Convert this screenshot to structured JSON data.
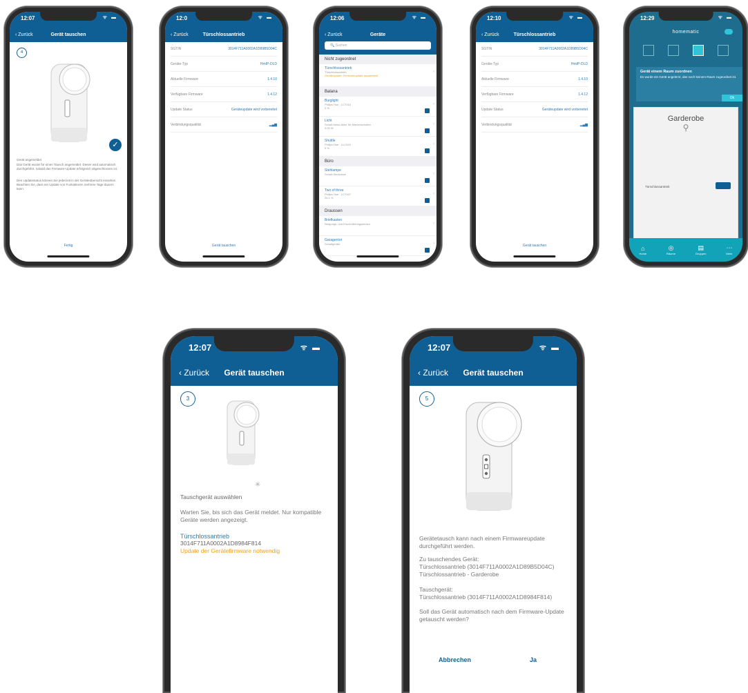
{
  "phones": [
    {
      "time": "12:07",
      "back_label": "Zurück",
      "title": "Gerät tauschen",
      "step": "4",
      "check_icon": "check-circle-icon",
      "text1_title": "Gerät angemeldet",
      "text1_body": "Das Gerät wurde für einen Tausch angemeldet. Dieser wird automatisch durchgeführt, sobald das Firmware-Update erfolgreich abgeschlossen ist.",
      "text2_body": "Den Updatestatus können Sie jederzeit in der Geräteübersicht einsehen. Beachten Sie, dass ein Update von Funkaktoren mehrere Tage dauern kann.",
      "footer": "Fertig"
    },
    {
      "time": "12:0",
      "back_label": "Zurück",
      "title": "Türschlossantrieb",
      "rows": [
        {
          "k": "SGTIN",
          "v": "3014F711A0002A1D89B5D04C"
        },
        {
          "k": "Geräte-Typ",
          "v": "HmIP-DLD"
        },
        {
          "k": "Aktuelle Firmware",
          "v": "1.4.10"
        },
        {
          "k": "Verfügbare Firmware",
          "v": "1.4.12"
        },
        {
          "k": "Update Status",
          "v": "Geräteupdate wird vorbereitet"
        },
        {
          "k": "Verbindungsqualität",
          "v": ""
        }
      ],
      "footer": "Gerät tauschen"
    },
    {
      "time": "12:06",
      "back_label": "Zurück",
      "title": "Geräte",
      "search_placeholder": "Suchen",
      "sections": [
        {
          "header": "Nicht zugeordnet",
          "items": [
            {
              "name": "Türschlossantrieb",
              "sub": "Türschlossantrieb",
              "warn": "Geräteupdate: Firmwareupdate ausstehend",
              "btn": false
            }
          ]
        },
        {
          "header": "Balana",
          "items": [
            {
              "name": "Burglight",
              "sub": "Philips Hue - LCT010",
              "val": "0 %",
              "btn": true
            },
            {
              "name": "Licht",
              "sub": "Schalt-Mess-Aktor für Markenschalter",
              "val": "0,00 W",
              "btn": true
            },
            {
              "name": "Shuttle",
              "sub": "Philips Hue - LLC020",
              "val": "0 %",
              "btn": true
            }
          ]
        },
        {
          "header": "Büro",
          "items": [
            {
              "name": "Stehlampe",
              "sub": "Schalt-Steckdose",
              "val": "",
              "btn": true
            },
            {
              "name": "Two of three",
              "sub": "Philips Hue - LCT007",
              "val": "26,1 %",
              "btn": true
            }
          ]
        },
        {
          "header": "Draussen",
          "items": [
            {
              "name": "Briefkasten",
              "sub": "Neigungs- und Erschütterungssensor",
              "val": "",
              "btn": false
            },
            {
              "name": "Garagentor",
              "sub": "Schaltgeräte",
              "val": "",
              "btn": true
            }
          ]
        }
      ]
    },
    {
      "time": "12:10",
      "back_label": "Zurück",
      "title": "Türschlossantrieb",
      "rows": [
        {
          "k": "SGTIN",
          "v": "3014F711A0002A1D89B5D04C"
        },
        {
          "k": "Geräte-Typ",
          "v": "HmIP-DLD"
        },
        {
          "k": "Aktuelle Firmware",
          "v": "1.4.10"
        },
        {
          "k": "Verfügbare Firmware",
          "v": "1.4.12"
        },
        {
          "k": "Update Status",
          "v": "Geräteupdate wird vorbereitet"
        },
        {
          "k": "Verbindungsqualität",
          "v": ""
        }
      ],
      "footer": "Gerät tauschen"
    },
    {
      "time": "12:29",
      "brand": "homematic",
      "banner_title": "Gerät einem Raum zuordnen",
      "banner_body": "Es wurde ein Gerät angelernt, das noch keinem Raum zugeordnet ist.",
      "banner_ok": "Ok",
      "room": "Garderobe",
      "device_label": "Türschlossantrieb",
      "tabs": [
        "Home",
        "Räume",
        "Gruppen",
        "Mehr"
      ]
    },
    {
      "time": "12:07",
      "back_label": "Zurück",
      "title": "Gerät tauschen",
      "step": "3",
      "select_label": "Tauschgerät auswählen",
      "wait_text": "Warten Sie, bis sich das Gerät meldet. Nur kompatible Geräte werden angezeigt.",
      "device_name": "Türschlossantrieb",
      "device_sgtin": "3014F711A0002A1D8984F814",
      "device_warn": "Update der Gerätefirmware notwendig"
    },
    {
      "time": "12:07",
      "back_label": "Zurück",
      "title": "Gerät tauschen",
      "step": "5",
      "p1": "Gerätetausch kann nach einem Firmwareupdate durchgeführt werden.",
      "p2_title": "Zu tauschendes Gerät:",
      "p2_line1": "Türschlossantrieb (3014F711A0002A1D89B5D04C)",
      "p2_line2": "Türschlossantrieb - Garderobe",
      "p3_title": "Tauschgerät:",
      "p3_line1": "Türschlossantrieb (3014F711A0002A1D8984F814)",
      "p4": "Soll das Gerät automatisch nach dem Firmware-Update getauscht werden?",
      "cancel": "Abbrechen",
      "confirm": "Ja"
    }
  ]
}
